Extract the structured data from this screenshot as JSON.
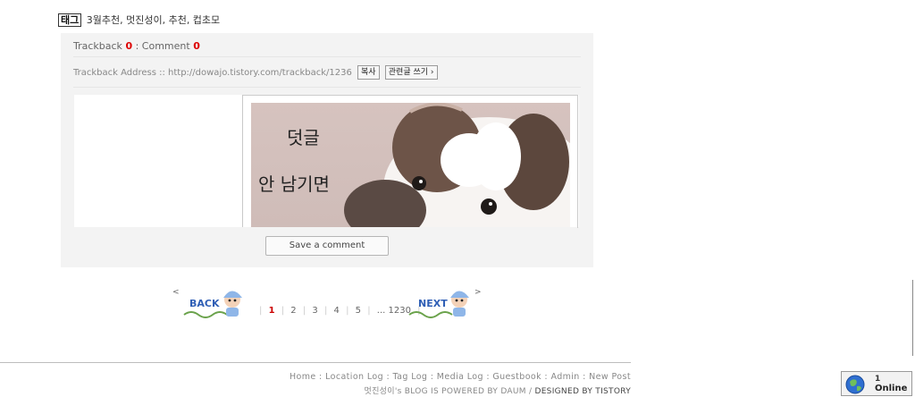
{
  "tags": {
    "label": "태그",
    "list": "3월추천, 멋진성이, 추천, 컵초모"
  },
  "panel": {
    "trackback_label": "Trackback",
    "trackback_count": "0",
    "separator": " : ",
    "comment_label": "Comment",
    "comment_count": "0",
    "address_label": "Trackback Address :: http://dowajo.tistory.com/trackback/1236",
    "copy_button": "복사",
    "related_button": "관련글 쓰기 ›",
    "image_text_line1": "덧글",
    "image_text_line2": "안 남기면",
    "save_comment_button": "Save a comment"
  },
  "pager": {
    "prev_arrow": "<",
    "back_label": "BACK",
    "pages": [
      "1",
      "2",
      "3",
      "4",
      "5"
    ],
    "last_page": "... 1230",
    "next_label": "NEXT",
    "next_arrow": ">"
  },
  "footer": {
    "links": "Home : Location Log : Tag Log : Media Log : Guestbook : Admin : New Post",
    "powered": "멋진성이's BLOG IS POWERED BY DAUM / ",
    "designed": "DESIGNED BY TISTORY"
  },
  "online": {
    "count": "1",
    "label": "Online"
  }
}
